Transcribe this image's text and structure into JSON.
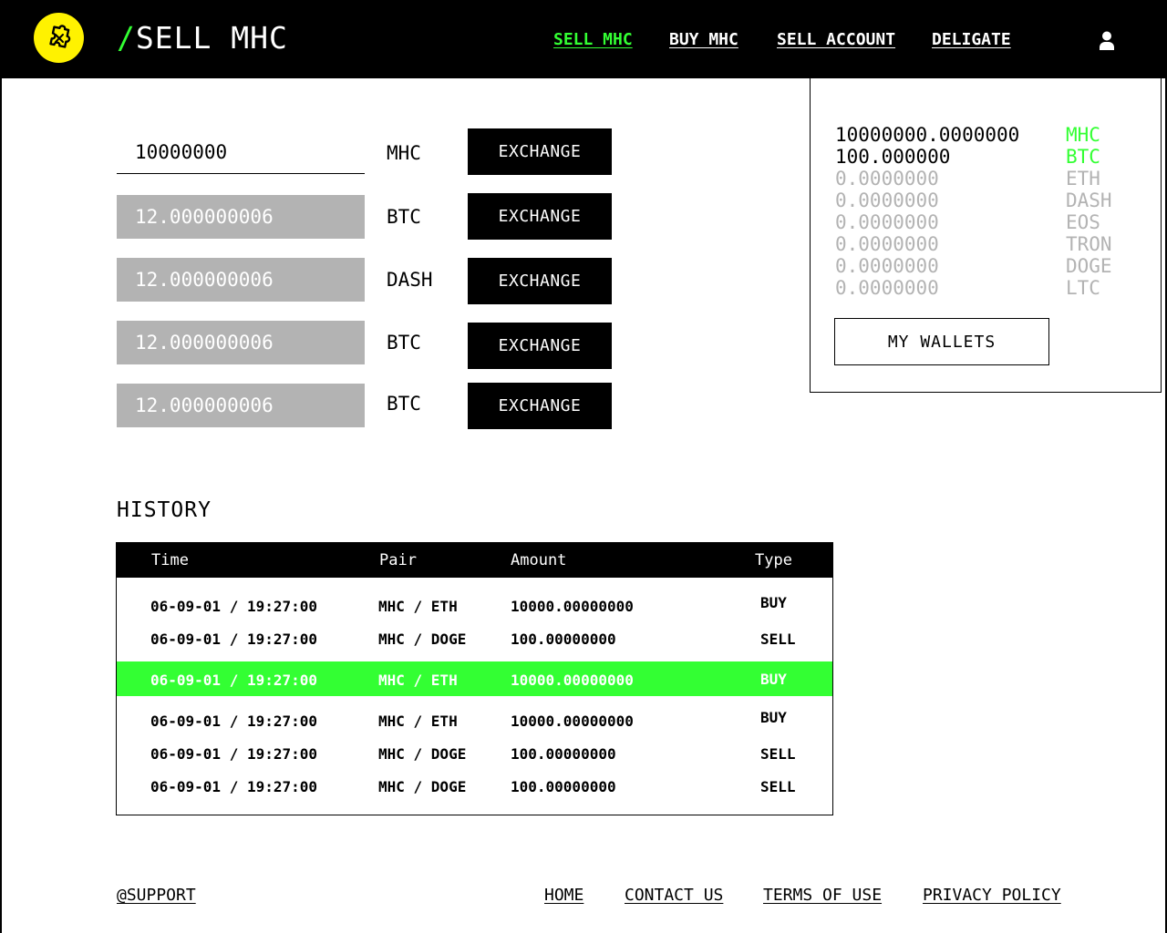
{
  "header": {
    "logo_icon": "puzzle-icon",
    "title_slash": "/",
    "title_text": "SELL MHC",
    "nav": [
      {
        "label": "SELL MHC",
        "active": true
      },
      {
        "label": "BUY MHC",
        "active": false
      },
      {
        "label": "SELL ACCOUNT",
        "active": false
      },
      {
        "label": "DELIGATE",
        "active": false
      }
    ],
    "user_icon": "user-icon"
  },
  "exchange": {
    "rows": [
      {
        "amount": "10000000",
        "currency": "MHC",
        "button": "EXCHANGE"
      },
      {
        "amount": "12.000000006",
        "currency": "BTC",
        "button": "EXCHANGE"
      },
      {
        "amount": "12.000000006",
        "currency": "DASH",
        "button": "EXCHANGE"
      },
      {
        "amount": "12.000000006",
        "currency": "BTC",
        "button": "EXCHANGE"
      },
      {
        "amount": "12.000000006",
        "currency": "BTC",
        "button": "EXCHANGE"
      }
    ]
  },
  "wallet": {
    "balances": [
      {
        "amount": "10000000.0000000",
        "currency": "MHC"
      },
      {
        "amount": "100.000000",
        "currency": "BTC"
      },
      {
        "amount": "0.0000000",
        "currency": "ETH"
      },
      {
        "amount": "0.0000000",
        "currency": "DASH"
      },
      {
        "amount": "0.0000000",
        "currency": "EOS"
      },
      {
        "amount": "0.0000000",
        "currency": "TRON"
      },
      {
        "amount": "0.0000000",
        "currency": "DOGE"
      },
      {
        "amount": "0.0000000",
        "currency": "LTC"
      }
    ],
    "button": "MY WALLETS"
  },
  "history": {
    "title": "HISTORY",
    "columns": [
      "Time",
      "Pair",
      "Amount",
      "Type"
    ],
    "rows": [
      {
        "time": "06-09-01 / 19:27:00",
        "pair": "MHC / ETH",
        "amount": "10000.00000000",
        "type": "BUY"
      },
      {
        "time": "06-09-01 / 19:27:00",
        "pair": "MHC / DOGE",
        "amount": "100.00000000",
        "type": "SELL"
      },
      {
        "time": "06-09-01 / 19:27:00",
        "pair": "MHC / ETH",
        "amount": "10000.00000000",
        "type": "BUY"
      },
      {
        "time": "06-09-01 / 19:27:00",
        "pair": "MHC / ETH",
        "amount": "10000.00000000",
        "type": "BUY"
      },
      {
        "time": "06-09-01 / 19:27:00",
        "pair": "MHC / DOGE",
        "amount": "100.00000000",
        "type": "SELL"
      },
      {
        "time": "06-09-01 / 19:27:00",
        "pair": "MHC / DOGE",
        "amount": "100.00000000",
        "type": "SELL"
      }
    ],
    "highlighted_row": 2
  },
  "footer": {
    "support": "@SUPPORT",
    "links": [
      "HOME",
      "CONTACT US",
      "TERMS OF USE",
      "PRIVACY POLICY"
    ]
  },
  "colors": {
    "accent": "#33ff33",
    "logo": "#fff200",
    "input_disabled": "#b3b3b3"
  }
}
